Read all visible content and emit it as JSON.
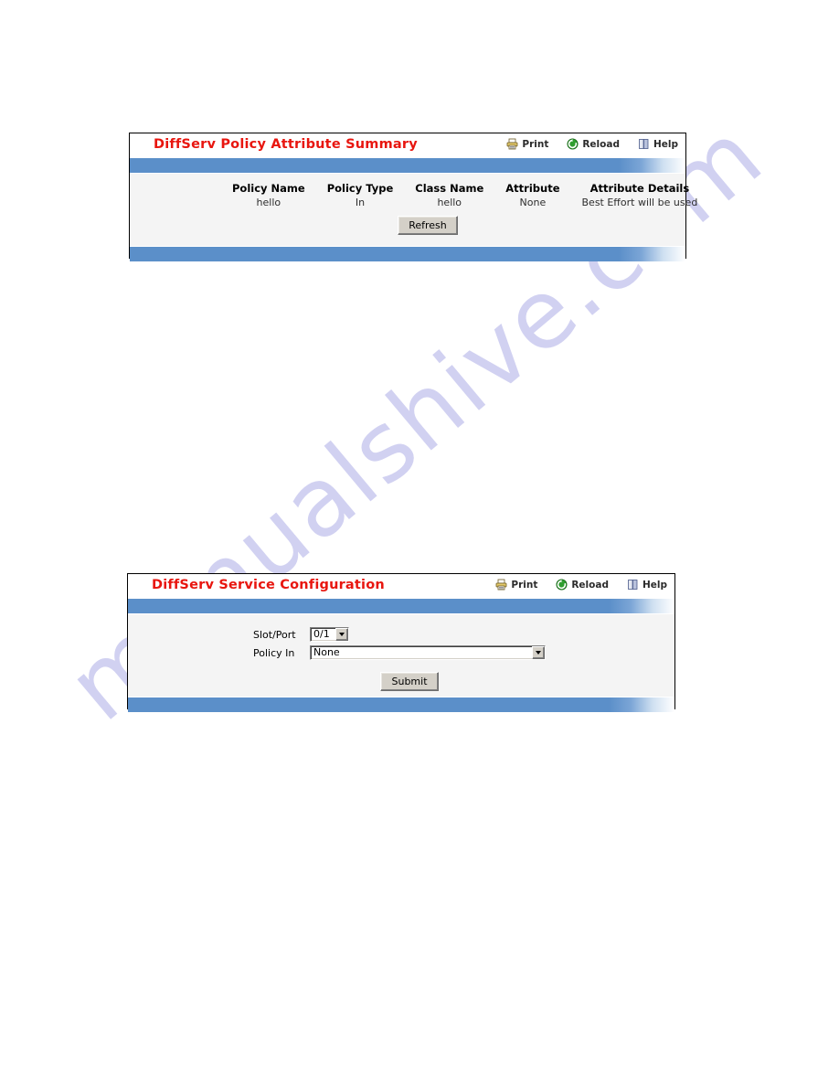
{
  "page": {
    "watermark_text": "manualshive.com",
    "accent_red": "#e8160f",
    "band_blue": "#5b8fc9",
    "body_gray": "#f4f4f4"
  },
  "tools": {
    "print_label": "Print",
    "reload_label": "Reload",
    "help_label": "Help"
  },
  "panel_summary": {
    "title": "DiffServ Policy Attribute Summary",
    "table": {
      "headers": [
        "Policy Name",
        "Policy Type",
        "Class Name",
        "Attribute",
        "Attribute Details"
      ],
      "rows": [
        [
          "hello",
          "In",
          "hello",
          "None",
          "Best Effort will be used"
        ]
      ]
    },
    "refresh_label": "Refresh"
  },
  "panel_service": {
    "title": "DiffServ Service Configuration",
    "fields": {
      "slot_port_label": "Slot/Port",
      "slot_port_value": "0/1",
      "policy_in_label": "Policy In",
      "policy_in_value": "None"
    },
    "submit_label": "Submit"
  }
}
